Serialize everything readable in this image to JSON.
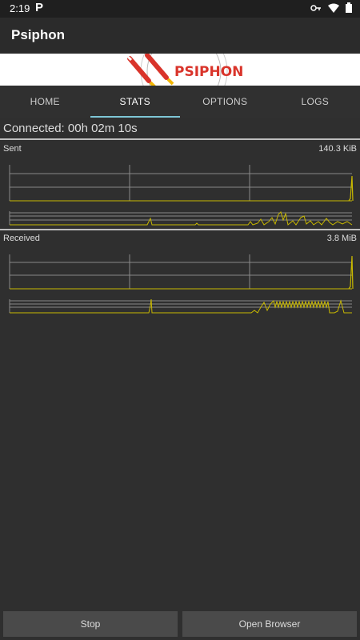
{
  "status_bar": {
    "time": "2:19",
    "app_glyph": "P"
  },
  "app": {
    "title": "Psiphon"
  },
  "banner": {
    "logo_text": "PSIPHON"
  },
  "tabs": [
    {
      "label": "HOME",
      "active": false
    },
    {
      "label": "STATS",
      "active": true
    },
    {
      "label": "OPTIONS",
      "active": false
    },
    {
      "label": "LOGS",
      "active": false
    }
  ],
  "connection": {
    "status": "Connected: 00h 02m 10s"
  },
  "sent": {
    "label": "Sent",
    "value": "140.3 KiB"
  },
  "received": {
    "label": "Received",
    "value": "3.8 MiB"
  },
  "buttons": {
    "stop": "Stop",
    "open_browser": "Open Browser"
  },
  "colors": {
    "accent": "#7ec6d6",
    "graph_line": "#c8b800",
    "banner_red": "#d9342b"
  }
}
